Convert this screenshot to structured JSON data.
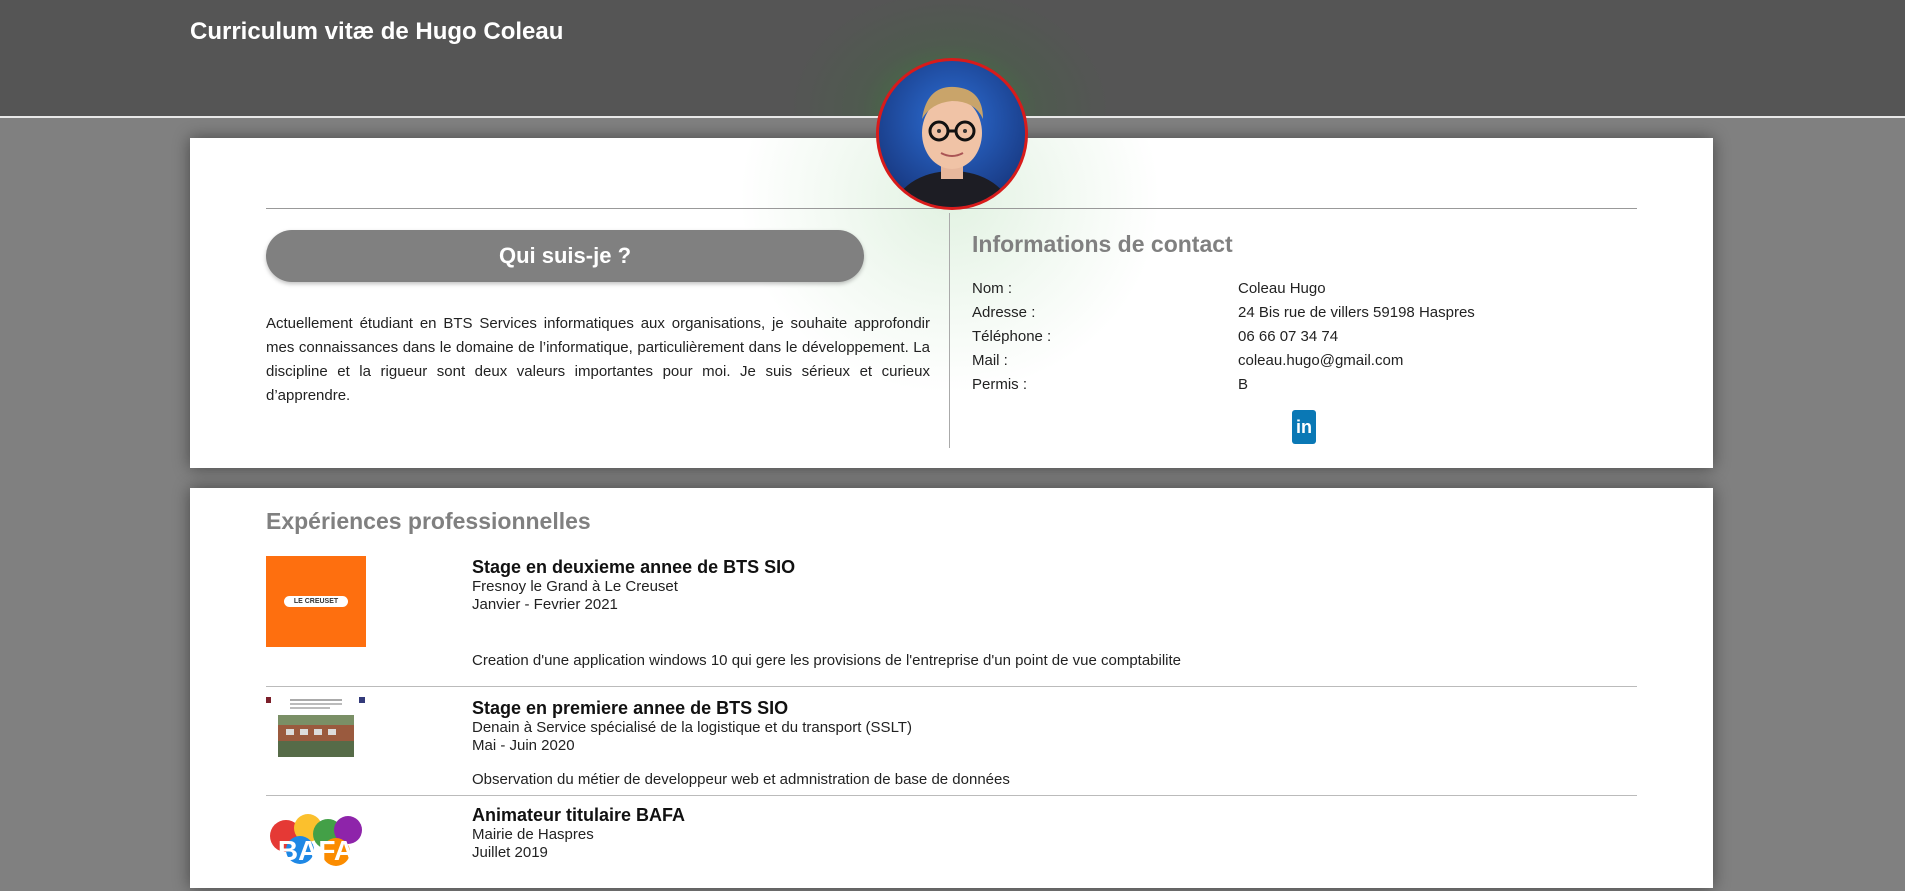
{
  "header": {
    "title": "Curriculum vitæ de Hugo Coleau"
  },
  "about": {
    "heading": "Qui suis-je ?",
    "text": "Actuellement étudiant en BTS Services informatiques aux organisations, je souhaite approfondir mes connaissances dans le domaine de l’informatique, particulièrement dans le développement. La discipline et la rigueur sont deux valeurs importantes pour moi. Je suis sérieux et curieux d’apprendre."
  },
  "contact": {
    "heading": "Informations de contact",
    "rows": [
      {
        "label": "Nom :",
        "value": "Coleau Hugo"
      },
      {
        "label": "Adresse :",
        "value": "24 Bis rue de villers 59198 Haspres"
      },
      {
        "label": "Téléphone :",
        "value": "06 66 07 34 74"
      },
      {
        "label": "Mail :",
        "value": "coleau.hugo@gmail.com"
      },
      {
        "label": "Permis :",
        "value": "B"
      }
    ],
    "linkedin_glyph": "in"
  },
  "experience": {
    "heading": "Expériences professionnelles",
    "items": [
      {
        "title": "Stage en deuxieme annee de BTS SIO",
        "place": "Fresnoy le Grand à Le Creuset",
        "dates": "Janvier - Fevrier 2021",
        "description": "Creation d'une application windows 10 qui gere les provisions de l'entreprise d'un point de vue comptabilite",
        "logo_text": "LE CREUSET"
      },
      {
        "title": "Stage en premiere annee de BTS SIO",
        "place": "Denain à Service spécialisé de la logistique et du transport (SSLT)",
        "dates": "Mai - Juin 2020",
        "description": "Observation du métier de developpeur web et admnistration de base de données"
      },
      {
        "title": "Animateur titulaire BAFA",
        "place": "Mairie de Haspres",
        "dates": "Juillet 2019",
        "logo_text": "BAFA"
      }
    ]
  },
  "colors": {
    "page_bg": "#808080",
    "header_bg": "#555555",
    "avatar_border": "#d81b1b",
    "pill_bg": "#808080",
    "linkedin": "#0a78b5",
    "creuset_orange": "#fe6f0f"
  }
}
